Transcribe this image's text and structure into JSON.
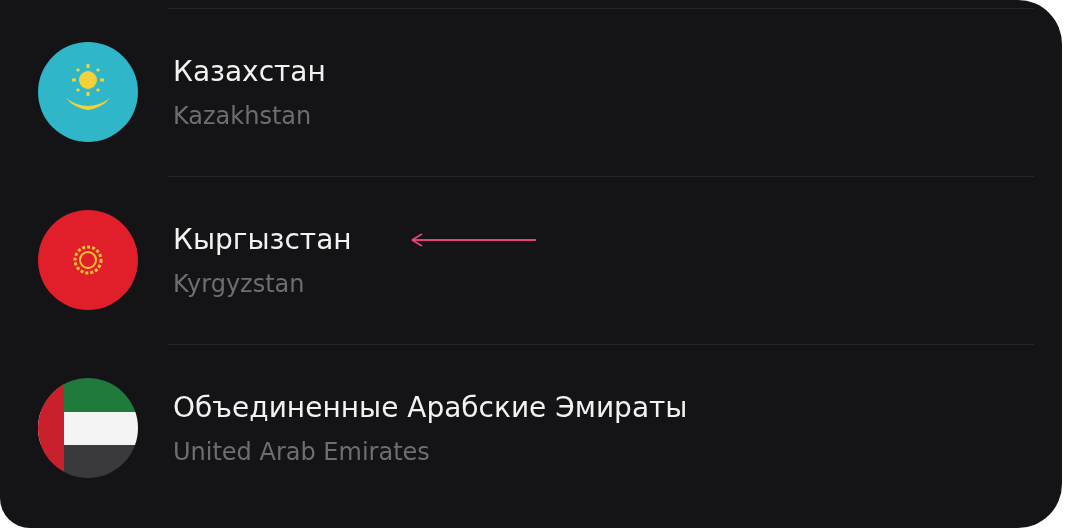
{
  "countries": [
    {
      "name": "Казахстан",
      "subtitle": "Kazakhstan",
      "kind": "kz",
      "marked": false
    },
    {
      "name": "Кыргызстан",
      "subtitle": "Kyrgyzstan",
      "kind": "kg",
      "marked": true
    },
    {
      "name": "Объединенные Арабские Эмираты",
      "subtitle": "United Arab Emirates",
      "kind": "ae",
      "marked": false
    }
  ]
}
